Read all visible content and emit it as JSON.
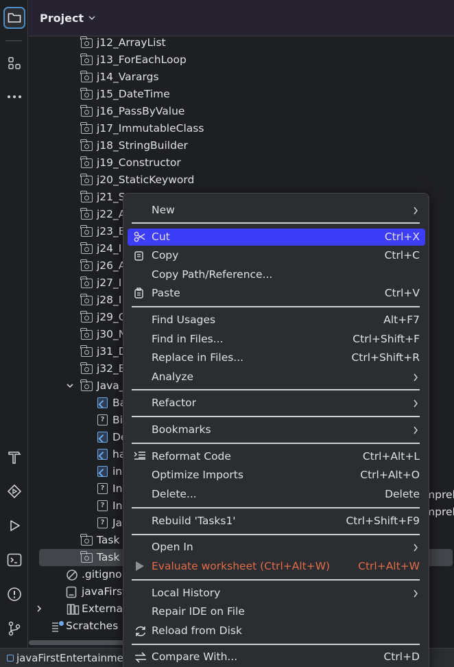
{
  "window": {
    "panel_title": "Project",
    "status_path": "javaFirstEntertainme"
  },
  "tree": {
    "items": [
      {
        "label": "j12_ArrayList",
        "icon": "folder-icon"
      },
      {
        "label": "j13_ForEachLoop",
        "icon": "folder-icon"
      },
      {
        "label": "j14_Varargs",
        "icon": "folder-icon"
      },
      {
        "label": "j15_DateTime",
        "icon": "folder-icon"
      },
      {
        "label": "j16_PassByValue",
        "icon": "folder-icon"
      },
      {
        "label": "j17_ImmutableClass",
        "icon": "folder-icon"
      },
      {
        "label": "j18_StringBuilder",
        "icon": "folder-icon"
      },
      {
        "label": "j19_Constructor",
        "icon": "folder-icon"
      },
      {
        "label": "j20_StaticKeyword",
        "icon": "folder-icon"
      },
      {
        "label": "j21_S",
        "icon": "folder-icon"
      },
      {
        "label": "j22_A",
        "icon": "folder-icon"
      },
      {
        "label": "j23_E",
        "icon": "folder-icon"
      },
      {
        "label": "j24_I",
        "icon": "folder-icon"
      },
      {
        "label": "j26_A",
        "icon": "folder-icon"
      },
      {
        "label": "j27_I",
        "icon": "folder-icon"
      },
      {
        "label": "j28_I",
        "icon": "folder-icon"
      },
      {
        "label": "j29_C",
        "icon": "folder-icon"
      },
      {
        "label": "j30_N",
        "icon": "folder-icon"
      },
      {
        "label": "j31_D",
        "icon": "folder-icon"
      },
      {
        "label": "j32_E",
        "icon": "folder-icon"
      },
      {
        "label": "Java_",
        "icon": "folder-icon"
      },
      {
        "label": "Ba",
        "icon": "image-file-icon"
      },
      {
        "label": "Bi",
        "icon": "unknown-file-icon"
      },
      {
        "label": "De",
        "icon": "image-file-icon"
      },
      {
        "label": "ha",
        "icon": "image-file-icon"
      },
      {
        "label": "in",
        "icon": "image-file-icon"
      },
      {
        "label": "In",
        "icon": "unknown-file-icon"
      },
      {
        "label": "In",
        "icon": "unknown-file-icon"
      },
      {
        "label": "Ja",
        "icon": "unknown-file-icon"
      },
      {
        "label": "Task",
        "icon": "folder-icon"
      },
      {
        "label": "Task",
        "icon": "folder-icon"
      },
      {
        "label": ".gitignor",
        "icon": "ignore-file-icon"
      },
      {
        "label": "javaFirst",
        "icon": "module-file-icon"
      },
      {
        "label": "External Lil",
        "icon": "library-icon"
      },
      {
        "label": "Scratches",
        "icon": "scratches-icon"
      }
    ],
    "right_overflow": [
      "mprel",
      "mprel"
    ]
  },
  "menu": {
    "items": [
      {
        "label": "New",
        "shortcut": "",
        "submenu": true
      },
      {
        "label": "Cut",
        "shortcut": "Ctrl+X",
        "icon": "scissors-icon",
        "active": true
      },
      {
        "label": "Copy",
        "shortcut": "Ctrl+C",
        "icon": "copy-icon"
      },
      {
        "label": "Copy Path/Reference...",
        "shortcut": ""
      },
      {
        "label": "Paste",
        "shortcut": "Ctrl+V",
        "icon": "paste-icon"
      },
      {
        "label": "Find Usages",
        "shortcut": "Alt+F7"
      },
      {
        "label": "Find in Files...",
        "shortcut": "Ctrl+Shift+F"
      },
      {
        "label": "Replace in Files...",
        "shortcut": "Ctrl+Shift+R"
      },
      {
        "label": "Analyze",
        "shortcut": "",
        "submenu": true
      },
      {
        "label": "Refactor",
        "shortcut": "",
        "submenu": true
      },
      {
        "label": "Bookmarks",
        "shortcut": "",
        "submenu": true
      },
      {
        "label": "Reformat Code",
        "shortcut": "Ctrl+Alt+L",
        "icon": "reformat-icon"
      },
      {
        "label": "Optimize Imports",
        "shortcut": "Ctrl+Alt+O"
      },
      {
        "label": "Delete...",
        "shortcut": "Delete"
      },
      {
        "label": "Rebuild 'Tasks1'",
        "shortcut": "Ctrl+Shift+F9"
      },
      {
        "label": "Open In",
        "shortcut": "",
        "submenu": true
      },
      {
        "label": "Evaluate worksheet (Ctrl+Alt+W)",
        "shortcut": "Ctrl+Alt+W",
        "icon": "run-icon",
        "disabled": true
      },
      {
        "label": "Local History",
        "shortcut": "",
        "submenu": true
      },
      {
        "label": "Repair IDE on File",
        "shortcut": ""
      },
      {
        "label": "Reload from Disk",
        "shortcut": "",
        "icon": "reload-icon"
      },
      {
        "label": "Compare With...",
        "shortcut": "Ctrl+D",
        "icon": "compare-icon"
      }
    ]
  },
  "colors": {
    "accent": "#3d3cf7",
    "header_bg": "#27222f",
    "disabled_text": "#e06c4a"
  }
}
